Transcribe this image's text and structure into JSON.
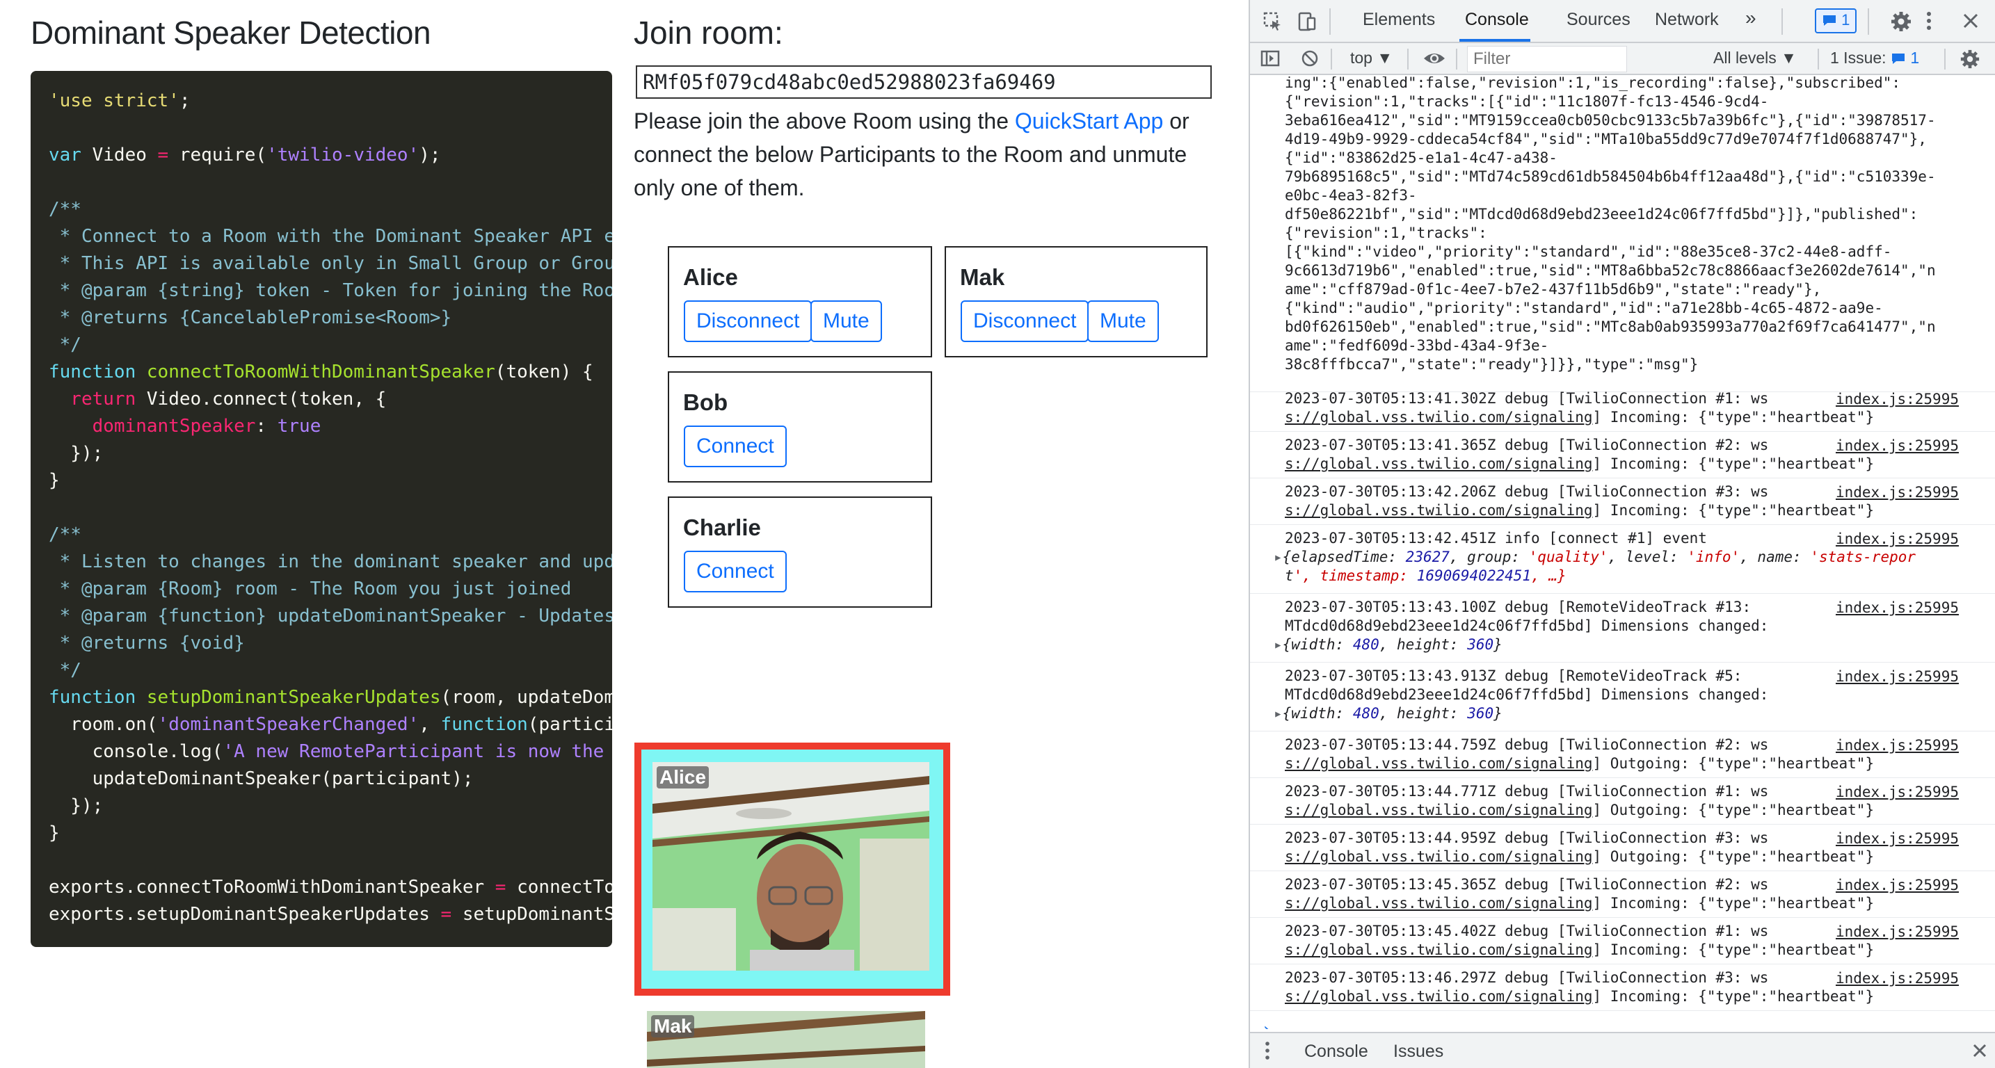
{
  "app": {
    "title": "Dominant Speaker Detection",
    "code_lines": [
      [
        [
          "str",
          "'use strict'"
        ],
        [
          "punc",
          ";"
        ]
      ],
      [],
      [
        [
          "kw",
          "var "
        ],
        [
          "plain",
          "Video "
        ],
        [
          "kwr",
          "= "
        ],
        [
          "plain",
          "require"
        ],
        [
          "punc",
          "("
        ],
        [
          "strp",
          "'twilio-video'"
        ],
        [
          "punc",
          ");"
        ]
      ],
      [],
      [
        [
          "com2",
          "/**"
        ]
      ],
      [
        [
          "com2",
          " * Connect to a Room with the Dominant Speaker API e"
        ]
      ],
      [
        [
          "com2",
          " * This API is available only in Small Group or Grou"
        ]
      ],
      [
        [
          "com2",
          " * @param {string} token - Token for joining the Roo"
        ]
      ],
      [
        [
          "com2",
          " * @returns {CancelablePromise<Room>}"
        ]
      ],
      [
        [
          "com2",
          " */"
        ]
      ],
      [
        [
          "kw",
          "function "
        ],
        [
          "fn",
          "connectToRoomWithDominantSpeaker"
        ],
        [
          "punc",
          "("
        ],
        [
          "plain",
          "token"
        ],
        [
          "punc",
          ") {"
        ]
      ],
      [
        [
          "kwr",
          "  return "
        ],
        [
          "plain",
          "Video"
        ],
        [
          "punc",
          "."
        ],
        [
          "plain",
          "connect"
        ],
        [
          "punc",
          "("
        ],
        [
          "plain",
          "token"
        ],
        [
          "punc",
          ", {"
        ]
      ],
      [
        [
          "prop",
          "    dominantSpeaker"
        ],
        [
          "punc",
          ": "
        ],
        [
          "bool",
          "true"
        ]
      ],
      [
        [
          "punc",
          "  });"
        ]
      ],
      [
        [
          "punc",
          "}"
        ]
      ],
      [],
      [
        [
          "com2",
          "/**"
        ]
      ],
      [
        [
          "com2",
          " * Listen to changes in the dominant speaker and upd"
        ]
      ],
      [
        [
          "com2",
          " * @param {Room} room - The Room you just joined"
        ]
      ],
      [
        [
          "com2",
          " * @param {function} updateDominantSpeaker - Updates"
        ]
      ],
      [
        [
          "com2",
          " * @returns {void}"
        ]
      ],
      [
        [
          "com2",
          " */"
        ]
      ],
      [
        [
          "kw",
          "function "
        ],
        [
          "fn",
          "setupDominantSpeakerUpdates"
        ],
        [
          "punc",
          "("
        ],
        [
          "plain",
          "room"
        ],
        [
          "punc",
          ", "
        ],
        [
          "plain",
          "updateDom"
        ]
      ],
      [
        [
          "plain",
          "  room"
        ],
        [
          "punc",
          "."
        ],
        [
          "plain",
          "on"
        ],
        [
          "punc",
          "("
        ],
        [
          "strp",
          "'dominantSpeakerChanged'"
        ],
        [
          "punc",
          ", "
        ],
        [
          "kw",
          "function"
        ],
        [
          "punc",
          "("
        ],
        [
          "plain",
          "partici"
        ]
      ],
      [
        [
          "plain",
          "    console"
        ],
        [
          "punc",
          "."
        ],
        [
          "plain",
          "log"
        ],
        [
          "punc",
          "("
        ],
        [
          "strp",
          "'A new RemoteParticipant is now the "
        ]
      ],
      [
        [
          "plain",
          "    updateDominantSpeaker"
        ],
        [
          "punc",
          "("
        ],
        [
          "plain",
          "participant"
        ],
        [
          "punc",
          ");"
        ]
      ],
      [
        [
          "punc",
          "  });"
        ]
      ],
      [
        [
          "punc",
          "}"
        ]
      ],
      [],
      [
        [
          "plain",
          "exports"
        ],
        [
          "punc",
          "."
        ],
        [
          "plain",
          "connectToRoomWithDominantSpeaker "
        ],
        [
          "kwr",
          "= "
        ],
        [
          "plain",
          "connectTo"
        ]
      ],
      [
        [
          "plain",
          "exports"
        ],
        [
          "punc",
          "."
        ],
        [
          "plain",
          "setupDominantSpeakerUpdates "
        ],
        [
          "kwr",
          "= "
        ],
        [
          "plain",
          "setupDominantS"
        ]
      ]
    ],
    "join": {
      "title": "Join room:",
      "room_name": "RMf05f079cd48abc0ed52988023fa69469",
      "instructions_before": "Please join the above Room using the ",
      "instructions_link": "QuickStart App",
      "instructions_after": " or connect the below Participants to the Room and unmute only one of them."
    },
    "participants": [
      {
        "name": "Alice",
        "buttons": [
          "Disconnect",
          "Mute"
        ]
      },
      {
        "name": "Mak",
        "buttons": [
          "Disconnect",
          "Mute"
        ]
      },
      {
        "name": "Bob",
        "buttons": [
          "Connect"
        ]
      },
      {
        "name": "Charlie",
        "buttons": [
          "Connect"
        ]
      }
    ],
    "videos": [
      {
        "label": "Alice",
        "dominant": true
      },
      {
        "label": "Mak",
        "dominant": false
      }
    ]
  },
  "devtools": {
    "tabs": [
      "Elements",
      "Console",
      "Sources",
      "Network"
    ],
    "active_tab": "Console",
    "more_tabs": "»",
    "message_badge": "1",
    "context": "top",
    "filter_placeholder": "Filter",
    "levels": "All levels",
    "issues_label": "1 Issue:",
    "issues_count": "1",
    "top_json": [
      "ing\":{\"enabled\":false,\"revision\":1,\"is_recording\":false},\"subscribed\":",
      "{\"revision\":1,\"tracks\":[{\"id\":\"11c1807f-fc13-4546-9cd4-",
      "3eba616ea412\",\"sid\":\"MT9159ccea0cb050cbc9133c5b7a39b6fc\"},{\"id\":\"39878517-",
      "4d19-49b9-9929-cddeca54cf84\",\"sid\":\"MTa10ba55dd9c77d9e7074f7f1d0688747\"},",
      "{\"id\":\"83862d25-e1a1-4c47-a438-",
      "79b6895168c5\",\"sid\":\"MTd74c589cd61db584504b6b4ff12aa48d\"},{\"id\":\"c510339e-",
      "e0bc-4ea3-82f3-",
      "df50e86221bf\",\"sid\":\"MTdcd0d68d9ebd23eee1d24c06f7ffd5bd\"}]},\"published\":",
      "{\"revision\":1,\"tracks\":",
      "[{\"kind\":\"video\",\"priority\":\"standard\",\"id\":\"88e35ce8-37c2-44e8-adff-",
      "9c6613d719b6\",\"enabled\":true,\"sid\":\"MT8a6bba52c78c8866aacf3e2602de7614\",\"n",
      "ame\":\"cff879ad-0f1c-4ee7-b7e2-437f11b5d6b9\",\"state\":\"ready\"},",
      "{\"kind\":\"audio\",\"priority\":\"standard\",\"id\":\"a71e28bb-4c65-4872-aa9e-",
      "bd0f626150eb\",\"enabled\":true,\"sid\":\"MTc8ab0ab935993a770a2f69f7ca641477\",\"n",
      "ame\":\"fedf609d-33bd-43a4-9f3e-",
      "38c8fffbcca7\",\"state\":\"ready\"}]}},\"type\":\"msg\"}"
    ],
    "logs": [
      {
        "line1": "2023-07-30T05:13:41.302Z debug [TwilioConnection #1: ws",
        "line2a": "s://global.vss.twilio.com/signaling",
        "line2b": "] Incoming: {\"type\":\"heartbeat\"}",
        "src": "index.js:25995"
      },
      {
        "line1": "2023-07-30T05:13:41.365Z debug [TwilioConnection #2: ws",
        "line2a": "s://global.vss.twilio.com/signaling",
        "line2b": "] Incoming: {\"type\":\"heartbeat\"}",
        "src": "index.js:25995"
      },
      {
        "line1": "2023-07-30T05:13:42.206Z debug [TwilioConnection #3: ws",
        "line2a": "s://global.vss.twilio.com/signaling",
        "line2b": "] Incoming: {\"type\":\"heartbeat\"}",
        "src": "index.js:25995"
      },
      {
        "line1": "2023-07-30T05:13:42.451Z info [connect #1] event",
        "obj_line1": "{elapsedTime: 23627, group: 'quality', level: 'info', name: 'stats-repor",
        "obj_line2": "t', timestamp: 1690694022451, …}",
        "src": "index.js:25995"
      },
      {
        "line1": "2023-07-30T05:13:43.100Z debug [RemoteVideoTrack #13:",
        "line2a": "MTdcd0d68d9ebd23eee1d24c06f7ffd5bd] Dimensions changed:",
        "obj": "{width: 480, height: 360}",
        "src": "index.js:25995"
      },
      {
        "line1": "2023-07-30T05:13:43.913Z debug [RemoteVideoTrack #5:",
        "line2a": "MTdcd0d68d9ebd23eee1d24c06f7ffd5bd] Dimensions changed:",
        "obj": "{width: 480, height: 360}",
        "src": "index.js:25995"
      },
      {
        "line1": "2023-07-30T05:13:44.759Z debug [TwilioConnection #2: ws",
        "line2a": "s://global.vss.twilio.com/signaling",
        "line2b": "] Outgoing: {\"type\":\"heartbeat\"}",
        "src": "index.js:25995"
      },
      {
        "line1": "2023-07-30T05:13:44.771Z debug [TwilioConnection #1: ws",
        "line2a": "s://global.vss.twilio.com/signaling",
        "line2b": "] Outgoing: {\"type\":\"heartbeat\"}",
        "src": "index.js:25995"
      },
      {
        "line1": "2023-07-30T05:13:44.959Z debug [TwilioConnection #3: ws",
        "line2a": "s://global.vss.twilio.com/signaling",
        "line2b": "] Outgoing: {\"type\":\"heartbeat\"}",
        "src": "index.js:25995"
      },
      {
        "line1": "2023-07-30T05:13:45.365Z debug [TwilioConnection #2: ws",
        "line2a": "s://global.vss.twilio.com/signaling",
        "line2b": "] Incoming: {\"type\":\"heartbeat\"}",
        "src": "index.js:25995"
      },
      {
        "line1": "2023-07-30T05:13:45.402Z debug [TwilioConnection #1: ws",
        "line2a": "s://global.vss.twilio.com/signaling",
        "line2b": "] Incoming: {\"type\":\"heartbeat\"}",
        "src": "index.js:25995"
      },
      {
        "line1": "2023-07-30T05:13:46.297Z debug [TwilioConnection #3: ws",
        "line2a": "s://global.vss.twilio.com/signaling",
        "line2b": "] Incoming: {\"type\":\"heartbeat\"}",
        "src": "index.js:25995"
      }
    ],
    "prompt": "›",
    "drawer_tabs": [
      "Console",
      "Issues"
    ]
  },
  "icons": [
    "inspect-icon",
    "device-toolbar-icon",
    "sidebar-toggle-icon",
    "clear-console-icon",
    "eye-icon",
    "gear-icon",
    "kebab-icon",
    "close-icon"
  ],
  "colors": {
    "code_bg": "#272822",
    "link": "#0d6efd",
    "dominant_border": "#ee3b2d",
    "dominant_inner": "#7ff6f4",
    "devtools_accent": "#1a73e8"
  }
}
